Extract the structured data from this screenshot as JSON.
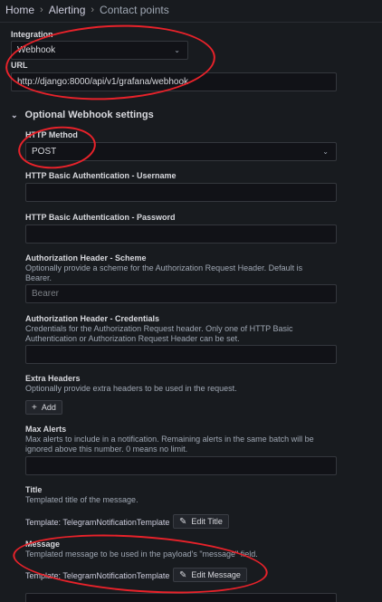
{
  "breadcrumb": [
    "Home",
    "Alerting",
    "Contact points"
  ],
  "integration": {
    "label": "Integration",
    "value": "Webhook"
  },
  "url": {
    "label": "URL",
    "value": "http://django:8000/api/v1/grafana/webhook"
  },
  "optional_section": {
    "label": "Optional Webhook settings"
  },
  "http_method": {
    "label": "HTTP Method",
    "value": "POST"
  },
  "basic_user": {
    "label": "HTTP Basic Authentication - Username",
    "value": ""
  },
  "basic_pass": {
    "label": "HTTP Basic Authentication - Password",
    "value": ""
  },
  "auth_scheme": {
    "label": "Authorization Header - Scheme",
    "desc": "Optionally provide a scheme for the Authorization Request Header. Default is Bearer.",
    "placeholder": "Bearer"
  },
  "auth_creds": {
    "label": "Authorization Header - Credentials",
    "desc": "Credentials for the Authorization Request header. Only one of HTTP Basic Authentication or Authorization Request Header can be set.",
    "value": ""
  },
  "extra_headers": {
    "label": "Extra Headers",
    "desc": "Optionally provide extra headers to be used in the request.",
    "add_label": "Add"
  },
  "max_alerts": {
    "label": "Max Alerts",
    "desc": "Max alerts to include in a notification. Remaining alerts in the same batch will be ignored above this number. 0 means no limit.",
    "value": ""
  },
  "title": {
    "label": "Title",
    "desc": "Templated title of the message.",
    "template": "Template: TelegramNotificationTemplate",
    "edit_label": "Edit Title"
  },
  "message": {
    "label": "Message",
    "desc": "Templated message to be used in the payload's \"message\" field.",
    "template": "Template: TelegramNotificationTemplate",
    "edit_label": "Edit Message"
  },
  "colors": {
    "background": "#181b1f",
    "input_bg": "#111217",
    "annotation": "#e8222a"
  }
}
